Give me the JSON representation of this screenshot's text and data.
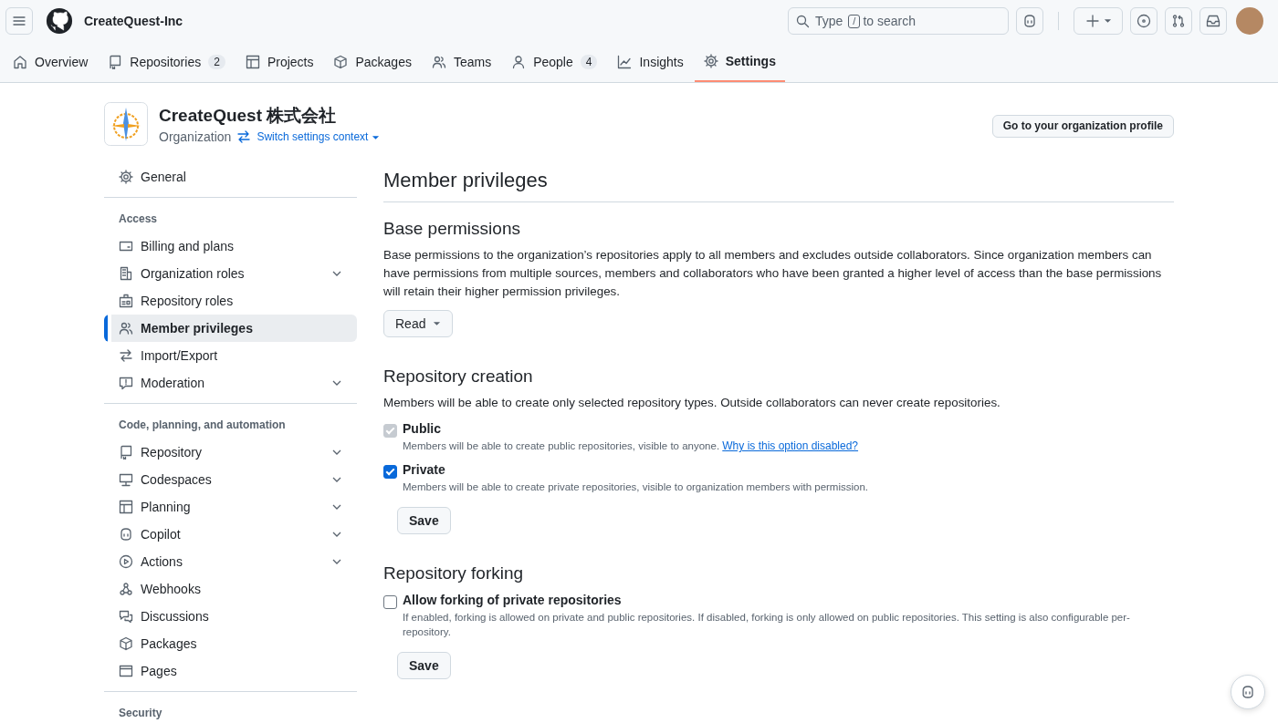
{
  "header": {
    "org_name": "CreateQuest-Inc",
    "search": {
      "prompt": "Type",
      "shortcut_key": "/",
      "prompt_end": "to search"
    }
  },
  "tabs": [
    {
      "label": "Overview",
      "selected": false
    },
    {
      "label": "Repositories",
      "count": "2",
      "selected": false
    },
    {
      "label": "Projects",
      "selected": false
    },
    {
      "label": "Packages",
      "selected": false
    },
    {
      "label": "Teams",
      "selected": false
    },
    {
      "label": "People",
      "count": "4",
      "selected": false
    },
    {
      "label": "Insights",
      "selected": false
    },
    {
      "label": "Settings",
      "selected": true
    }
  ],
  "org": {
    "name": "CreateQuest 株式会社",
    "type": "Organization",
    "switch_link": "Switch settings context",
    "profile_button": "Go to your organization profile"
  },
  "sidebar": {
    "sections": [
      {
        "items": [
          {
            "label": "General",
            "selected": false,
            "has_submenu": false
          }
        ]
      },
      {
        "heading": "Access",
        "items": [
          {
            "label": "Billing and plans",
            "selected": false,
            "has_submenu": false
          },
          {
            "label": "Organization roles",
            "selected": false,
            "has_submenu": true
          },
          {
            "label": "Repository roles",
            "selected": false,
            "has_submenu": false
          },
          {
            "label": "Member privileges",
            "selected": true,
            "has_submenu": false
          },
          {
            "label": "Import/Export",
            "selected": false,
            "has_submenu": false
          },
          {
            "label": "Moderation",
            "selected": false,
            "has_submenu": true
          }
        ]
      },
      {
        "heading": "Code, planning, and automation",
        "items": [
          {
            "label": "Repository",
            "selected": false,
            "has_submenu": true
          },
          {
            "label": "Codespaces",
            "selected": false,
            "has_submenu": true
          },
          {
            "label": "Planning",
            "selected": false,
            "has_submenu": true
          },
          {
            "label": "Copilot",
            "selected": false,
            "has_submenu": true
          },
          {
            "label": "Actions",
            "selected": false,
            "has_submenu": true
          },
          {
            "label": "Webhooks",
            "selected": false,
            "has_submenu": false
          },
          {
            "label": "Discussions",
            "selected": false,
            "has_submenu": false
          },
          {
            "label": "Packages",
            "selected": false,
            "has_submenu": false
          },
          {
            "label": "Pages",
            "selected": false,
            "has_submenu": false
          }
        ]
      },
      {
        "heading": "Security"
      }
    ]
  },
  "page": {
    "title": "Member privileges",
    "sections": [
      {
        "kind": "dropdown",
        "heading": "Base permissions",
        "description": "Base permissions to the organization’s repositories apply to all members and excludes outside collaborators. Since organization members can have permissions from multiple sources, members and collaborators who have been granted a higher level of access than the base permissions will retain their higher permission privileges.",
        "dropdown": "Read"
      },
      {
        "kind": "checkboxes",
        "heading": "Repository creation",
        "description": "Members will be able to create only selected repository types. Outside collaborators can never create repositories.",
        "options": [
          {
            "label": "Public",
            "description": "Members will be able to create public repositories, visible to anyone.",
            "link": "Why is this option disabled?",
            "checked": true,
            "disabled": true
          },
          {
            "label": "Private",
            "description": "Members will be able to create private repositories, visible to organization members with permission.",
            "checked": true,
            "disabled": false
          }
        ],
        "save": "Save"
      },
      {
        "kind": "checkboxes",
        "heading": "Repository forking",
        "options": [
          {
            "label": "Allow forking of private repositories",
            "description": "If enabled, forking is allowed on private and public repositories. If disabled, forking is only allowed on public repositories. This setting is also configurable per-repository.",
            "checked": false,
            "disabled": false
          }
        ],
        "save": "Save"
      }
    ]
  }
}
